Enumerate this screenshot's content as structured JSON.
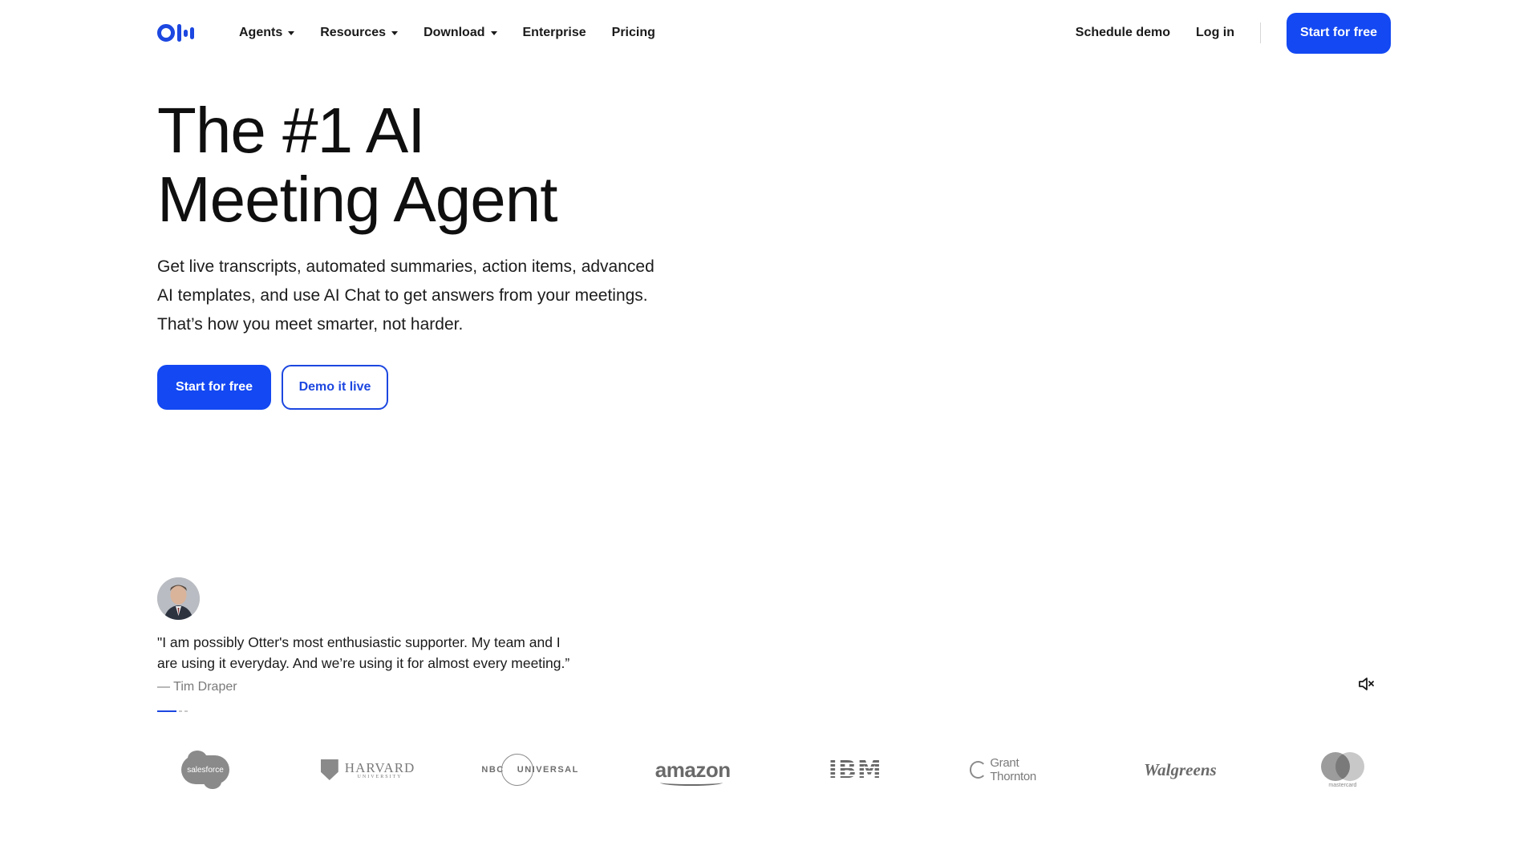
{
  "header": {
    "logo_name": "otter-logo",
    "nav": [
      {
        "label": "Agents",
        "dropdown": true
      },
      {
        "label": "Resources",
        "dropdown": true
      },
      {
        "label": "Download",
        "dropdown": true
      },
      {
        "label": "Enterprise",
        "dropdown": false
      },
      {
        "label": "Pricing",
        "dropdown": false
      }
    ],
    "schedule_demo": "Schedule demo",
    "log_in": "Log in",
    "start_free": "Start for free"
  },
  "hero": {
    "title_line1": "The #1 AI",
    "title_line2": "Meeting Agent",
    "subtitle_line1": "Get live transcripts, automated summaries, action items, advanced",
    "subtitle_line2": "AI templates, and use AI Chat to get answers from your meetings.",
    "subtitle_line3": "That’s how you meet smarter, not harder.",
    "cta_primary": "Start for free",
    "cta_secondary": "Demo it live"
  },
  "testimonial": {
    "quote_line1": "\"I am possibly Otter's most enthusiastic supporter. My team and I",
    "quote_line2": "are using it everyday. And we’re using it for almost every meeting.”",
    "author": "— Tim Draper",
    "slides_total": 3,
    "slides_active": 1
  },
  "logos": {
    "salesforce": "salesforce",
    "harvard": "HARVARD",
    "harvard_sub": "UNIVERSITY",
    "nbc": "NBC",
    "nbc_universal": "UNIVERSAL",
    "amazon": "amazon",
    "ibm": "IBM",
    "grant_thornton": "Grant Thornton",
    "walgreens": "Walgreens",
    "mastercard": "mastercard"
  },
  "colors": {
    "brand_blue": "#1348f2",
    "text_dark": "#0f0f0f",
    "muted": "#7a7a7a"
  },
  "icons": {
    "mute": "speaker-muted-icon",
    "caret": "caret-down-icon"
  }
}
